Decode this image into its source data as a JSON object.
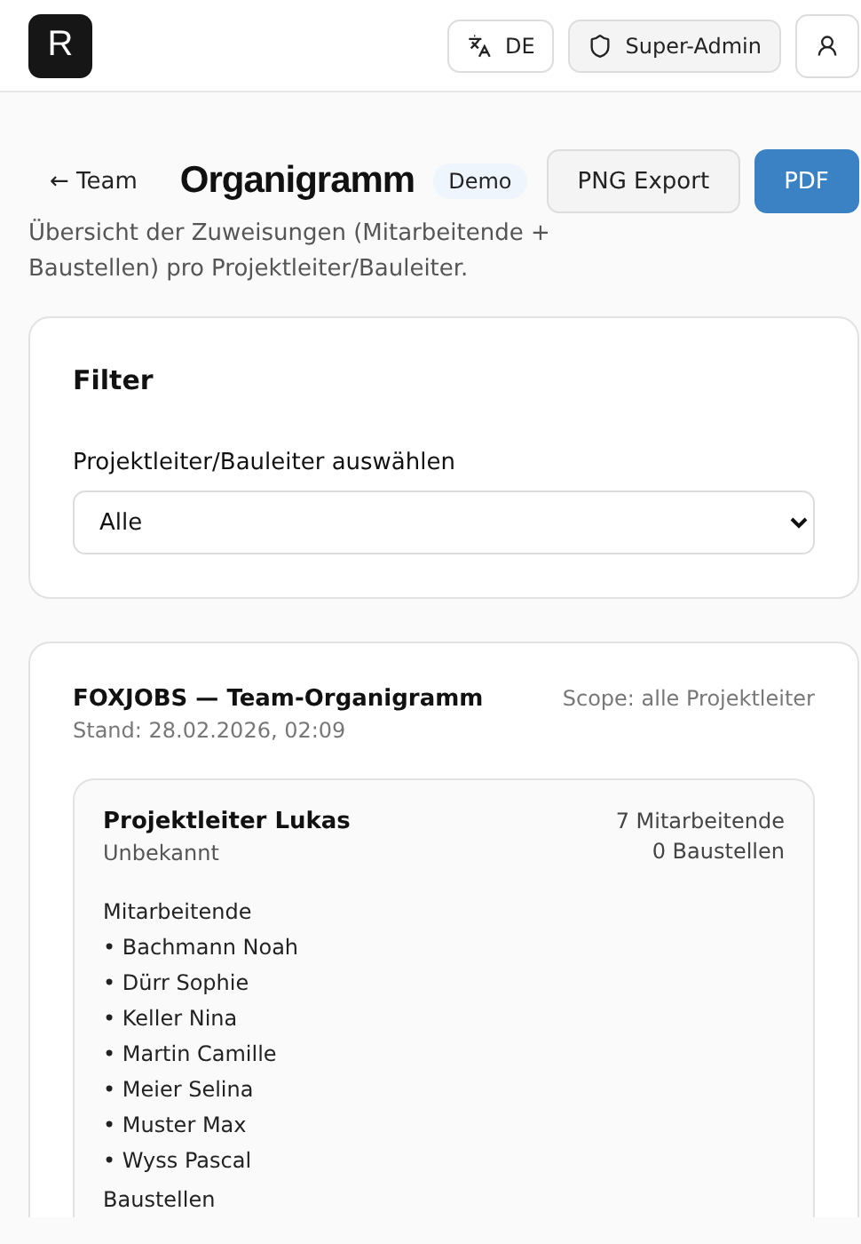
{
  "header": {
    "logo": "R",
    "language": "DE",
    "role": "Super-Admin"
  },
  "page": {
    "back_link": "← Team",
    "title": "Organigramm",
    "badge": "Demo",
    "buttons": [
      {
        "label": "PNG Export",
        "kind": "secondary"
      },
      {
        "label": "PDF",
        "kind": "primary"
      }
    ],
    "subtitle": "Übersicht der Zuweisungen (Mitarbeitende + Baustellen) pro Projektleiter/Bauleiter."
  },
  "filter": {
    "title": "Filter",
    "label": "Projektleiter/Bauleiter auswählen",
    "value": "Alle"
  },
  "org": {
    "title": "FOXJOBS — Team-Organigramm",
    "stand": "Stand: 28.02.2026, 02:09",
    "scope": "Scope: alle Projektleiter",
    "leaders": [
      {
        "name": "Projektleiter Lukas",
        "role": "Unbekannt",
        "employee_count": "7 Mitarbeitende",
        "site_count": "0 Baustellen",
        "employees_heading": "Mitarbeitende",
        "employees": [
          "• Bachmann Noah",
          "• Dürr Sophie",
          "• Keller Nina",
          "• Martin Camille",
          "• Meier Selina",
          "• Muster Max",
          "• Wyss Pascal"
        ],
        "sites_heading": "Baustellen"
      }
    ]
  }
}
